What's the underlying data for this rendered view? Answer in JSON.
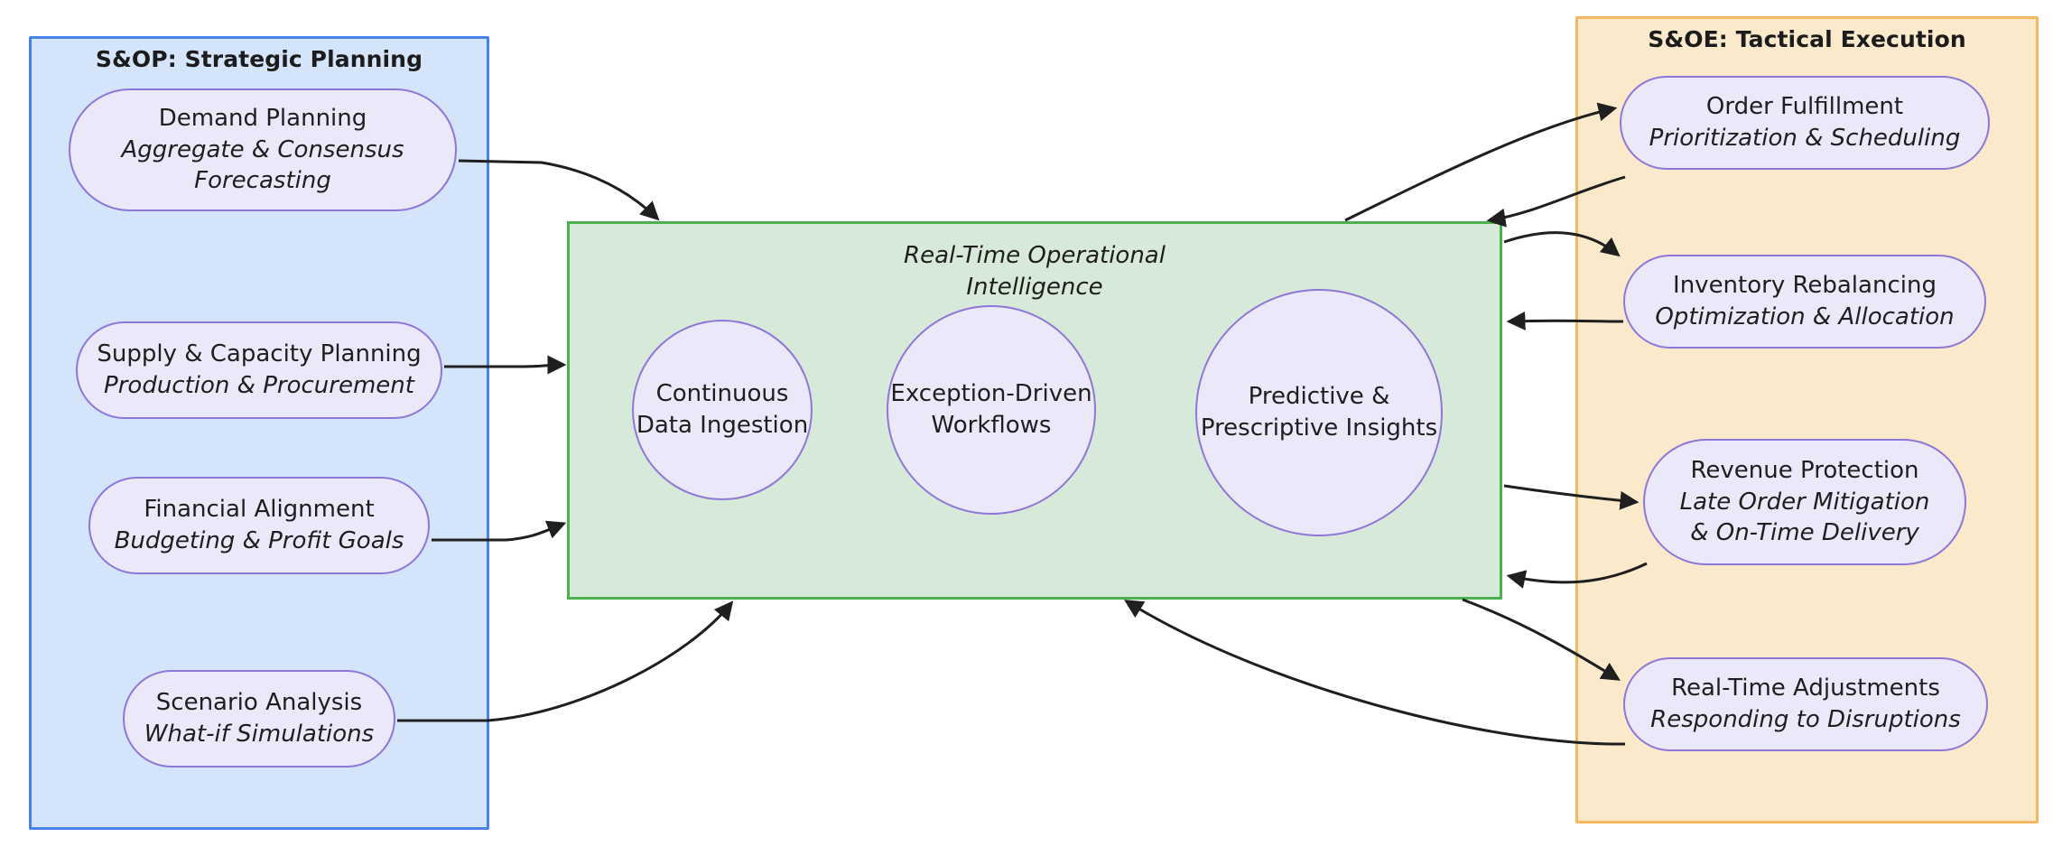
{
  "diagram": {
    "type": "flowchart",
    "title_center": "Real-Time Operational\nIntelligence"
  },
  "clusters": {
    "left": {
      "title": "S&OP: Strategic Planning",
      "fill": "#d3e4fb",
      "stroke": "#4783e8",
      "nodes": [
        {
          "id": "demand-planning",
          "line1": "Demand Planning",
          "line2": "Aggregate & Consensus",
          "line3": "Forecasting"
        },
        {
          "id": "supply-capacity-planning",
          "line1": "Supply & Capacity Planning",
          "line2": "Production & Procurement",
          "line3": ""
        },
        {
          "id": "financial-alignment",
          "line1": "Financial Alignment",
          "line2": "Budgeting & Profit Goals",
          "line3": ""
        },
        {
          "id": "scenario-analysis",
          "line1": "Scenario Analysis",
          "line2": "What-if Simulations",
          "line3": ""
        }
      ]
    },
    "right": {
      "title": "S&OE: Tactical Execution",
      "fill": "#fae9ca",
      "stroke": "#f5b860",
      "nodes": [
        {
          "id": "order-fulfillment",
          "line1": "Order Fulfillment",
          "line2": "Prioritization & Scheduling",
          "line3": ""
        },
        {
          "id": "inventory-rebalancing",
          "line1": "Inventory Rebalancing",
          "line2": "Optimization & Allocation",
          "line3": ""
        },
        {
          "id": "revenue-protection",
          "line1": "Revenue Protection",
          "line2": "Late Order Mitigation",
          "line3": "& On-Time Delivery"
        },
        {
          "id": "real-time-adjustments",
          "line1": "Real-Time Adjustments",
          "line2": "Responding to Disruptions",
          "line3": ""
        }
      ]
    },
    "center": {
      "title_line1": "Real-Time Operational",
      "title_line2": "Intelligence",
      "fill": "#d7e9d8",
      "stroke": "#4caf50",
      "nodes": [
        {
          "id": "continuous-data-ingestion",
          "line1": "Continuous",
          "line2": "Data Ingestion"
        },
        {
          "id": "exception-driven-workflows",
          "line1": "Exception-Driven",
          "line2": "Workflows"
        },
        {
          "id": "predictive-prescriptive-insights",
          "line1": "Predictive &",
          "line2": "Prescriptive Insights"
        }
      ]
    }
  },
  "colors": {
    "node_fill": "#ebe8fa",
    "node_stroke": "#8e77d8",
    "edge": "#1f1f1f",
    "text": "#1e1e1e"
  },
  "edges": [
    {
      "from": "demand-planning",
      "to": "center",
      "direction": "one-way"
    },
    {
      "from": "supply-capacity-planning",
      "to": "center",
      "direction": "one-way"
    },
    {
      "from": "financial-alignment",
      "to": "center",
      "direction": "one-way"
    },
    {
      "from": "scenario-analysis",
      "to": "center",
      "direction": "one-way"
    },
    {
      "from": "center",
      "to": "order-fulfillment",
      "direction": "two-way"
    },
    {
      "from": "center",
      "to": "inventory-rebalancing",
      "direction": "two-way"
    },
    {
      "from": "center",
      "to": "revenue-protection",
      "direction": "two-way"
    },
    {
      "from": "center",
      "to": "real-time-adjustments",
      "direction": "two-way"
    }
  ]
}
